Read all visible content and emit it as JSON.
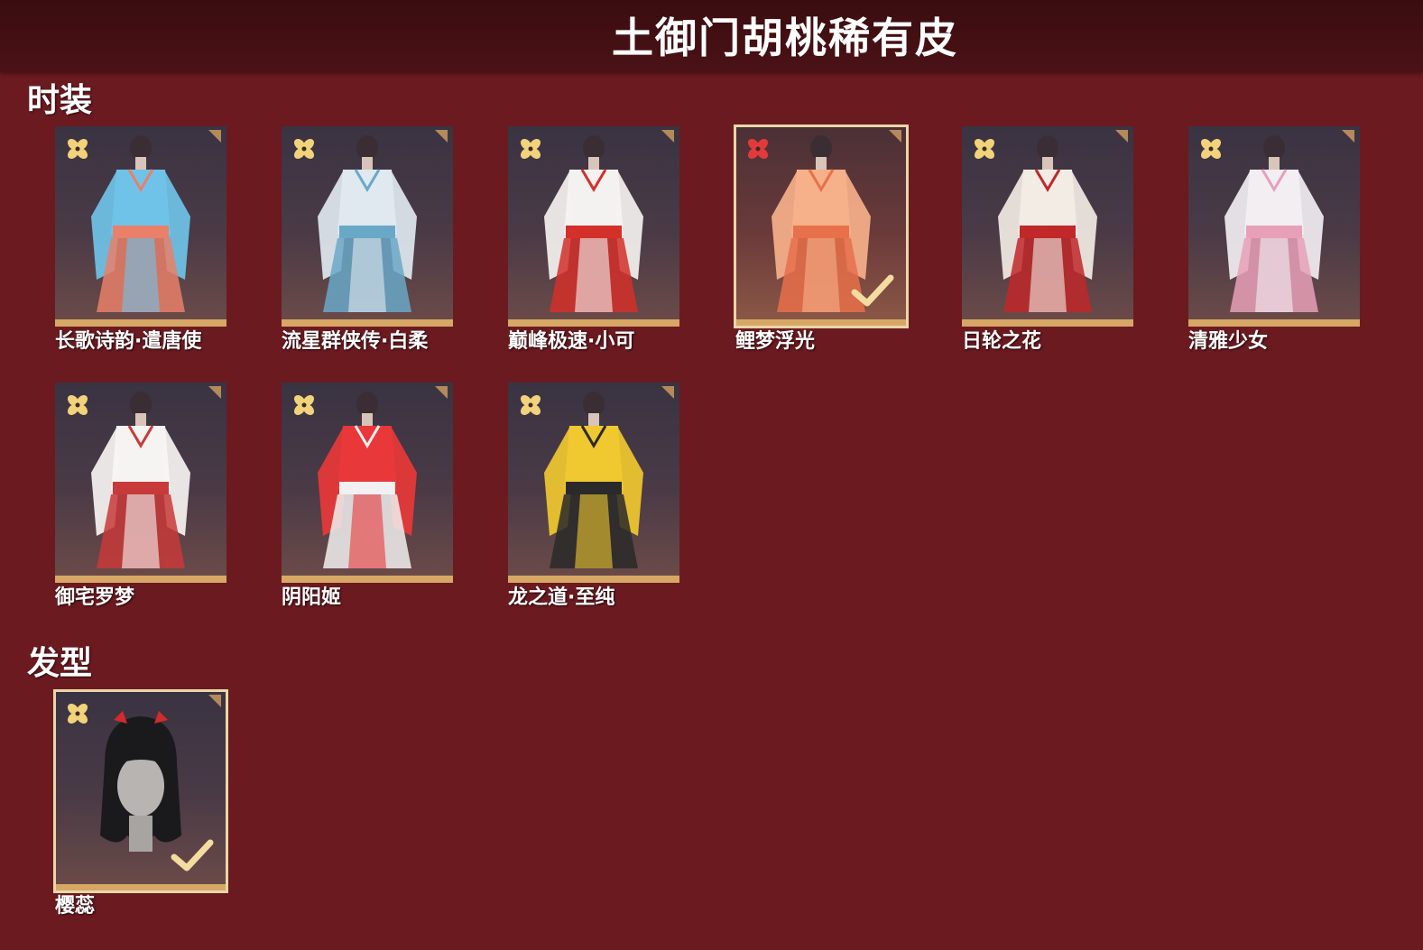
{
  "header": {
    "title": "土御门胡桃稀有皮"
  },
  "sections": {
    "costume": {
      "title": "时装",
      "items": [
        {
          "label": "长歌诗韵·遣唐使",
          "colors": [
            "#6fc3e8",
            "#e8806a"
          ],
          "selected": false
        },
        {
          "label": "流星群侠传·白柔",
          "colors": [
            "#e0e8f0",
            "#6aa8c8"
          ],
          "selected": false
        },
        {
          "label": "巅峰极速·小可",
          "colors": [
            "#f4f2f0",
            "#d4302a"
          ],
          "selected": false
        },
        {
          "label": "鲤梦浮光",
          "colors": [
            "#f6b08a",
            "#e8704a"
          ],
          "selected": true
        },
        {
          "label": "日轮之花",
          "colors": [
            "#f2ece4",
            "#c0282a"
          ],
          "selected": false
        },
        {
          "label": "清雅少女",
          "colors": [
            "#f2eef2",
            "#e8a0b8"
          ],
          "selected": false
        },
        {
          "label": "御宅罗梦",
          "colors": [
            "#f6f4f2",
            "#c83a3a"
          ],
          "selected": false
        },
        {
          "label": "阴阳姬",
          "colors": [
            "#e8383a",
            "#f2f0f0"
          ],
          "selected": false
        },
        {
          "label": "龙之道·至纯",
          "colors": [
            "#f0c830",
            "#2a2a2a"
          ],
          "selected": false
        }
      ]
    },
    "hairstyle": {
      "title": "发型",
      "items": [
        {
          "label": "樱蕊",
          "colors": [
            "#1a1a1c",
            "#d42a2a"
          ],
          "selected": true
        }
      ]
    }
  },
  "icons": {
    "rarity": "gold-flower-icon",
    "rarity_selected": "red-flower-icon",
    "check": "check-icon"
  },
  "theme": {
    "background": "#6b1a20",
    "header_background": "#3a0c10",
    "tile_border": "#d7a765",
    "rarity_gold": "#f2d27a",
    "rarity_red": "#e23a3a"
  }
}
